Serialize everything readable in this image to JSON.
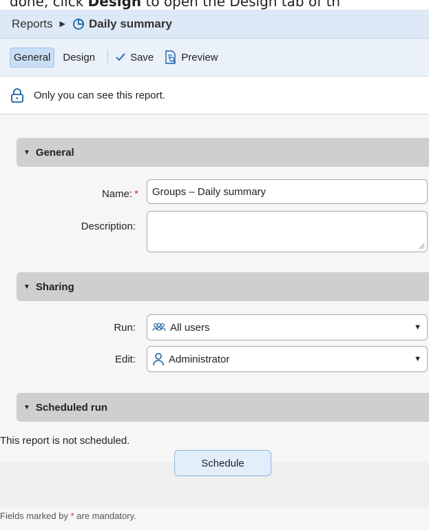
{
  "caption": {
    "pre": "done, click ",
    "bold": "Design",
    "post": " to open the Design tab of th"
  },
  "breadcrumb": {
    "root": "Reports",
    "current": "Daily summary"
  },
  "toolbar": {
    "tab_general": "General",
    "tab_design": "Design",
    "save": "Save",
    "preview": "Preview"
  },
  "notice": {
    "text": "Only you can see this report."
  },
  "general": {
    "header": "General",
    "name_label": "Name:",
    "required_mark": "*",
    "name_value": "Groups – Daily summary",
    "description_label": "Description:",
    "description_value": ""
  },
  "sharing": {
    "header": "Sharing",
    "run_label": "Run:",
    "run_value": "All users",
    "edit_label": "Edit:",
    "edit_value": "Administrator"
  },
  "scheduled": {
    "header": "Scheduled run",
    "status": "This report is not scheduled.",
    "button": "Schedule"
  },
  "footnote": {
    "pre": "Fields marked by ",
    "mark": "*",
    "post": " are mandatory."
  },
  "icons": {
    "pie": "pie-chart-icon",
    "lock": "lock-icon",
    "check": "check-icon",
    "preview": "preview-icon",
    "group": "users-group-icon",
    "user": "user-icon"
  },
  "colors": {
    "accent": "#1a5fa6",
    "required": "#c0392b",
    "header_bg": "#dde9f6"
  }
}
